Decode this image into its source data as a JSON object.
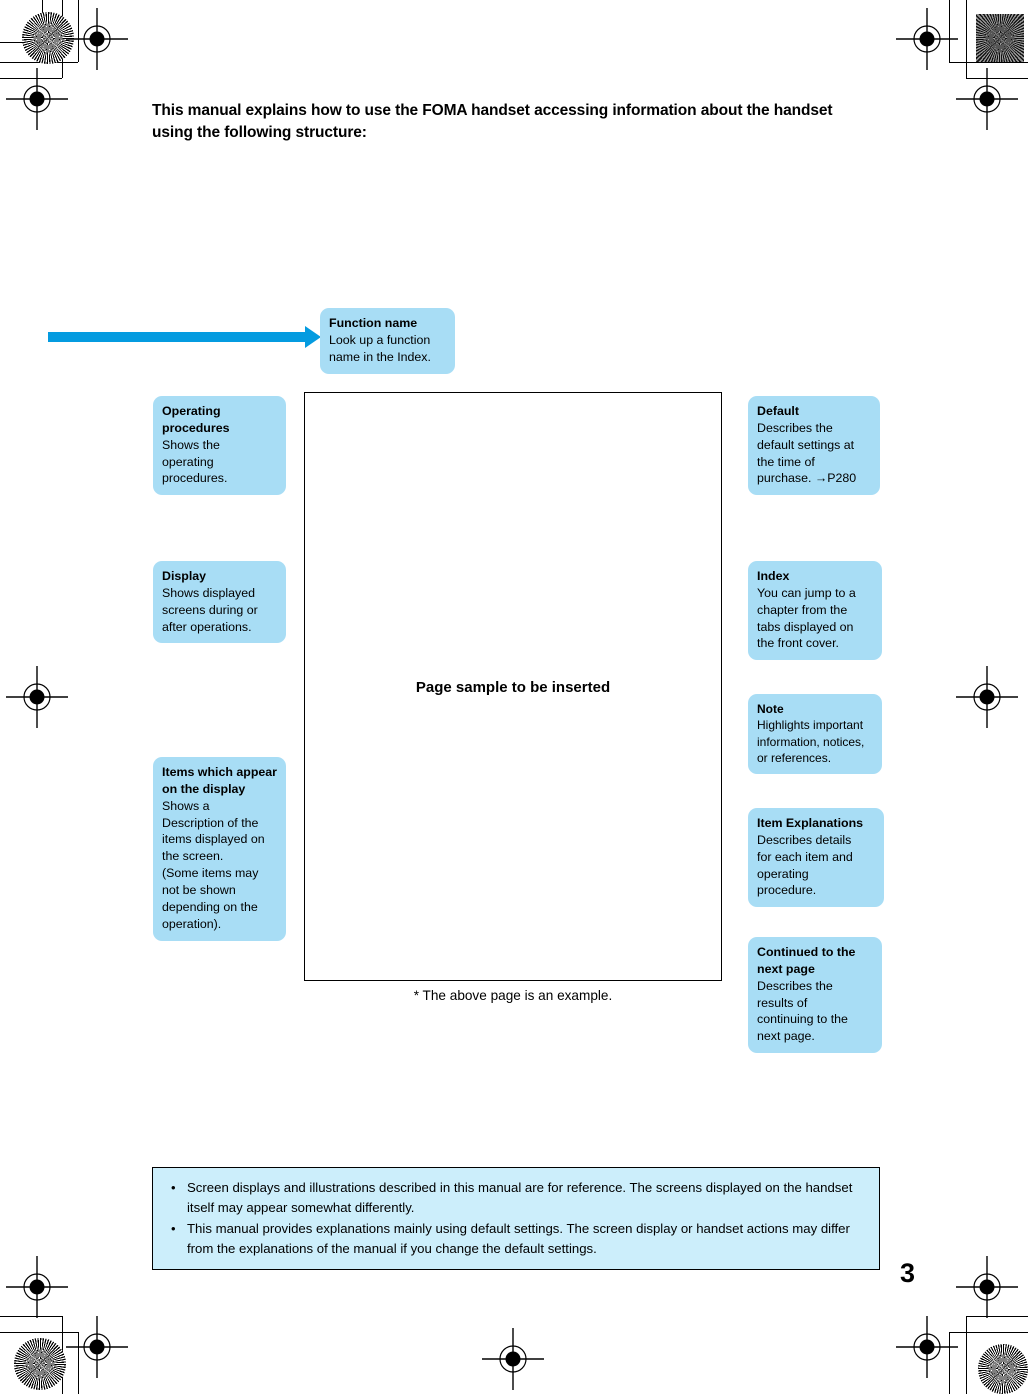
{
  "document": {
    "headline": "This manual explains how to use the FOMA handset accessing information about the handset using the following structure:",
    "page_number": "3",
    "sample_frame_label": "Page sample to be inserted",
    "frame_note": "* The above page is an example."
  },
  "colors": {
    "callout_fill": "#a8ddf5",
    "arrow": "#049be0",
    "notice_fill": "#cceefb",
    "frame_border": "#000000"
  },
  "callouts": {
    "function_name": {
      "title": "Function name",
      "body": "Look up a function\nname in the Index."
    },
    "operating_procedures": {
      "title": "Operating\nprocedures",
      "body": "Shows the\noperating\nprocedures."
    },
    "display": {
      "title": "Display",
      "body": "Shows displayed\nscreens during or\nafter operations."
    },
    "items_on_display": {
      "title": "Items which\nappear on the\ndisplay",
      "body": "Shows a\nDescription of the\nitems displayed on\nthe screen.\n(Some items may\nnot be shown\ndepending on the\noperation)."
    },
    "default": {
      "title": "Default",
      "body": "Describes the\ndefault settings at\nthe time of\npurchase. →P280"
    },
    "index": {
      "title": "Index",
      "body": "You can jump to a\nchapter from the\ntabs displayed on\nthe front cover."
    },
    "note": {
      "title": "Note",
      "body": "Highlights important\ninformation, notices,\nor references."
    },
    "item_explanations": {
      "title": "Item Explanations",
      "body": "Describes details\nfor each item and\noperating\nprocedure."
    },
    "continued_next_page": {
      "title": "Continued to the\nnext page",
      "body": "Describes the\nresults of\ncontinuing to the\nnext page."
    }
  },
  "notice": {
    "bullet_glyph": "•",
    "items": [
      "Screen displays and illustrations described in this manual are for reference. The screens displayed on the handset itself may appear somewhat differently.",
      "This manual provides explanations mainly using default settings. The screen display or handset actions may differ from the explanations of the manual if you change the default settings."
    ]
  }
}
